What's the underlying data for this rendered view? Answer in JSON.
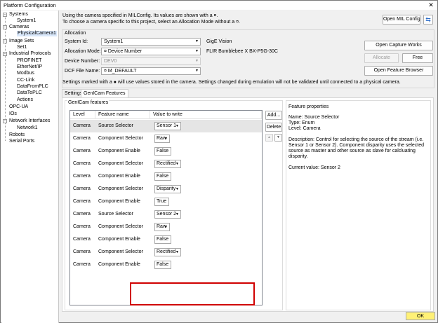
{
  "window": {
    "title": "Platform Configuration",
    "close_glyph": "✕"
  },
  "tree": {
    "systems": "Systems",
    "system1": "System1",
    "cameras": "Cameras",
    "physical_camera1": "PhysicalCamera1",
    "image_sets": "Image Sets",
    "set1": "Set1",
    "industrial_protocols": "Industrial Protocols",
    "profinet": "PROFINET",
    "ethernet_ip": "EtherNet/IP",
    "modbus": "Modbus",
    "cc_link": "CC-Link",
    "data_from_plc": "DataFromPLC",
    "data_to_plc": "DataToPLC",
    "actions": "Actions",
    "opc_ua": "OPC-UA",
    "ios": "IOs",
    "network_interfaces": "Network Interfaces",
    "network1": "Network1",
    "robots": "Robots",
    "serial_ports": "Serial Ports"
  },
  "info": {
    "line1": "Using the camera specified in MILConfig.  Its values are shown with a ¤.",
    "line2": "To choose a camera specific to this project, select an Allocation Mode without a ¤.",
    "open_mil_config": "Open MIL Config"
  },
  "allocation": {
    "title": "Allocation",
    "system_id_label": "System Id:",
    "system_id_value": "System1",
    "allocation_mode_label": "Allocation Mode:",
    "allocation_mode_value": "¤ Device Number",
    "device_number_label": "Device Number:",
    "device_number_value": "DEV0",
    "dcf_label": "DCF File Name:",
    "dcf_value": "¤ M_DEFAULT",
    "camera_type": "GigE Vision",
    "camera_model": "FLIR Bumblebee X BX-P5G-30C",
    "open_capture_works": "Open Capture Works",
    "allocate": "Allocate",
    "free": "Free",
    "open_feature_browser": "Open Feature Browser"
  },
  "warning": "Settings marked with a ● will use values stored in the camera.  Settings changed during emulation will not be validated until connected to a physical camera.",
  "tabs": {
    "settings": "Settings",
    "genicam": "GenICam Features"
  },
  "genicam": {
    "group_title": "GenICam features",
    "headers": {
      "level": "Level",
      "feature": "Feature name",
      "value": "Value to write"
    },
    "rows": [
      {
        "level": "Camera",
        "feature": "Source Selector",
        "value": "Sensor 1"
      },
      {
        "level": "Camera",
        "feature": "Component Selector",
        "value": "Raw"
      },
      {
        "level": "Camera",
        "feature": "Component Enable",
        "value": "False"
      },
      {
        "level": "Camera",
        "feature": "Component Selector",
        "value": "Rectified"
      },
      {
        "level": "Camera",
        "feature": "Component Enable",
        "value": "False"
      },
      {
        "level": "Camera",
        "feature": "Component Selector",
        "value": "Disparity"
      },
      {
        "level": "Camera",
        "feature": "Component Enable",
        "value": "True"
      },
      {
        "level": "Camera",
        "feature": "Source Selector",
        "value": "Sensor 2"
      },
      {
        "level": "Camera",
        "feature": "Component Selector",
        "value": "Raw"
      },
      {
        "level": "Camera",
        "feature": "Component Enable",
        "value": "False"
      },
      {
        "level": "Camera",
        "feature": "Component Selector",
        "value": "Rectified"
      },
      {
        "level": "Camera",
        "feature": "Component Enable",
        "value": "False"
      }
    ],
    "add": "Add...",
    "delete": "Delete",
    "up": "▲",
    "down": "▼"
  },
  "feature_properties": {
    "title": "Feature properties",
    "name": "Name: Source Selector",
    "type": "Type: Enum",
    "level": "Level: Camera",
    "description": "Description: Control for selecting the source of the stream (i.e. Sensor 1 or Sensor 2). Component disparity uses the selected source as master and other source as slave for calcluating disparity.",
    "current_value": "Current value: Sensor 2"
  },
  "ok_button": "OK",
  "colors": {
    "highlight_red": "#d00000",
    "ok_highlight": "#fff176",
    "refresh_blue": "#2a6cc8"
  }
}
